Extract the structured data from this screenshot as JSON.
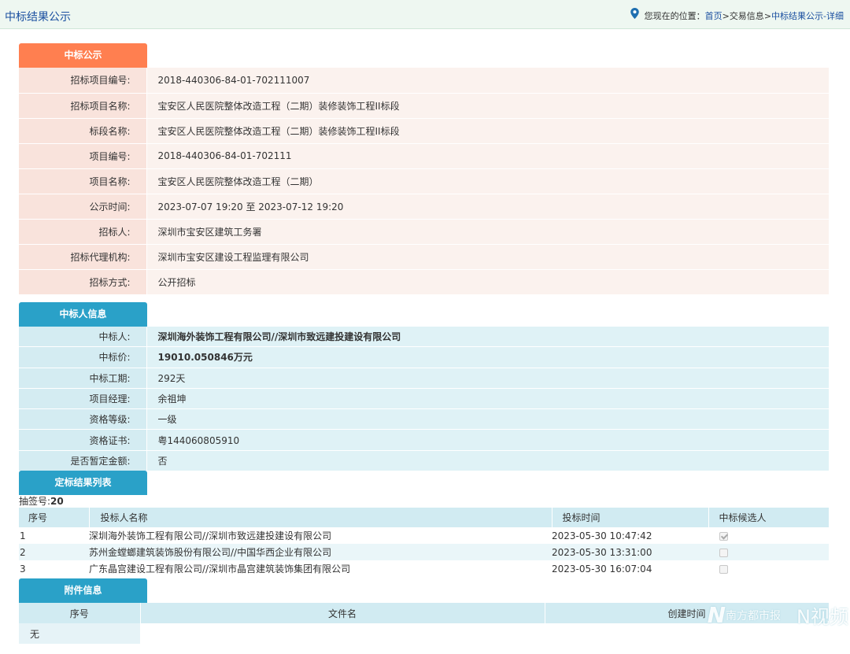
{
  "header": {
    "title": "中标结果公示",
    "location_prefix": "您现在的位置：",
    "crumb_home": "首页",
    "crumb_sep1": ">",
    "crumb_trade": "交易信息",
    "crumb_sep2": ">",
    "crumb_current": "中标结果公示-详细"
  },
  "award_notice": {
    "tab": "中标公示",
    "rows": [
      {
        "label": "招标项目编号:",
        "value": "2018-440306-84-01-702111007"
      },
      {
        "label": "招标项目名称:",
        "value": "宝安区人民医院整体改造工程（二期）装修装饰工程II标段"
      },
      {
        "label": "标段名称:",
        "value": "宝安区人民医院整体改造工程（二期）装修装饰工程II标段"
      },
      {
        "label": "项目编号:",
        "value": "2018-440306-84-01-702111"
      },
      {
        "label": "项目名称:",
        "value": "宝安区人民医院整体改造工程（二期）"
      },
      {
        "label": "公示时间:",
        "value": "2023-07-07 19:20 至 2023-07-12 19:20"
      },
      {
        "label": "招标人:",
        "value": "深圳市宝安区建筑工务署"
      },
      {
        "label": "招标代理机构:",
        "value": "深圳市宝安区建设工程监理有限公司"
      },
      {
        "label": "招标方式:",
        "value": "公开招标"
      }
    ]
  },
  "winner_info": {
    "tab": "中标人信息",
    "rows": [
      {
        "label": "中标人:",
        "value": "深圳海外装饰工程有限公司//深圳市致远建投建设有限公司"
      },
      {
        "label": "中标价:",
        "value": "19010.050846万元"
      },
      {
        "label": "中标工期:",
        "value": "292天"
      },
      {
        "label": "项目经理:",
        "value": "余祖坤"
      },
      {
        "label": "资格等级:",
        "value": "一级"
      },
      {
        "label": "资格证书:",
        "value": "粤144060805910"
      },
      {
        "label": "是否暂定金额:",
        "value": "否"
      }
    ]
  },
  "result_list": {
    "tab": "定标结果列表",
    "lottery_label": "抽签号:",
    "lottery_value": "20",
    "headers": {
      "no": "序号",
      "name": "投标人名称",
      "time": "投标时间",
      "candidate": "中标候选人"
    },
    "rows": [
      {
        "no": "1",
        "name": "深圳海外装饰工程有限公司//深圳市致远建投建设有限公司",
        "time": "2023-05-30 10:47:42",
        "checked": true
      },
      {
        "no": "2",
        "name": "苏州金螳螂建筑装饰股份有限公司//中国华西企业有限公司",
        "time": "2023-05-30 13:31:00",
        "checked": false
      },
      {
        "no": "3",
        "name": "广东晶宫建设工程有限公司//深圳市晶宫建筑装饰集团有限公司",
        "time": "2023-05-30 16:07:04",
        "checked": false
      }
    ]
  },
  "attachments": {
    "tab": "附件信息",
    "headers": {
      "no": "序号",
      "file": "文件名",
      "created": "创建时间"
    },
    "empty": "无"
  },
  "watermark": {
    "left": "N",
    "left_text": "南方都市报",
    "right": "N视频"
  }
}
